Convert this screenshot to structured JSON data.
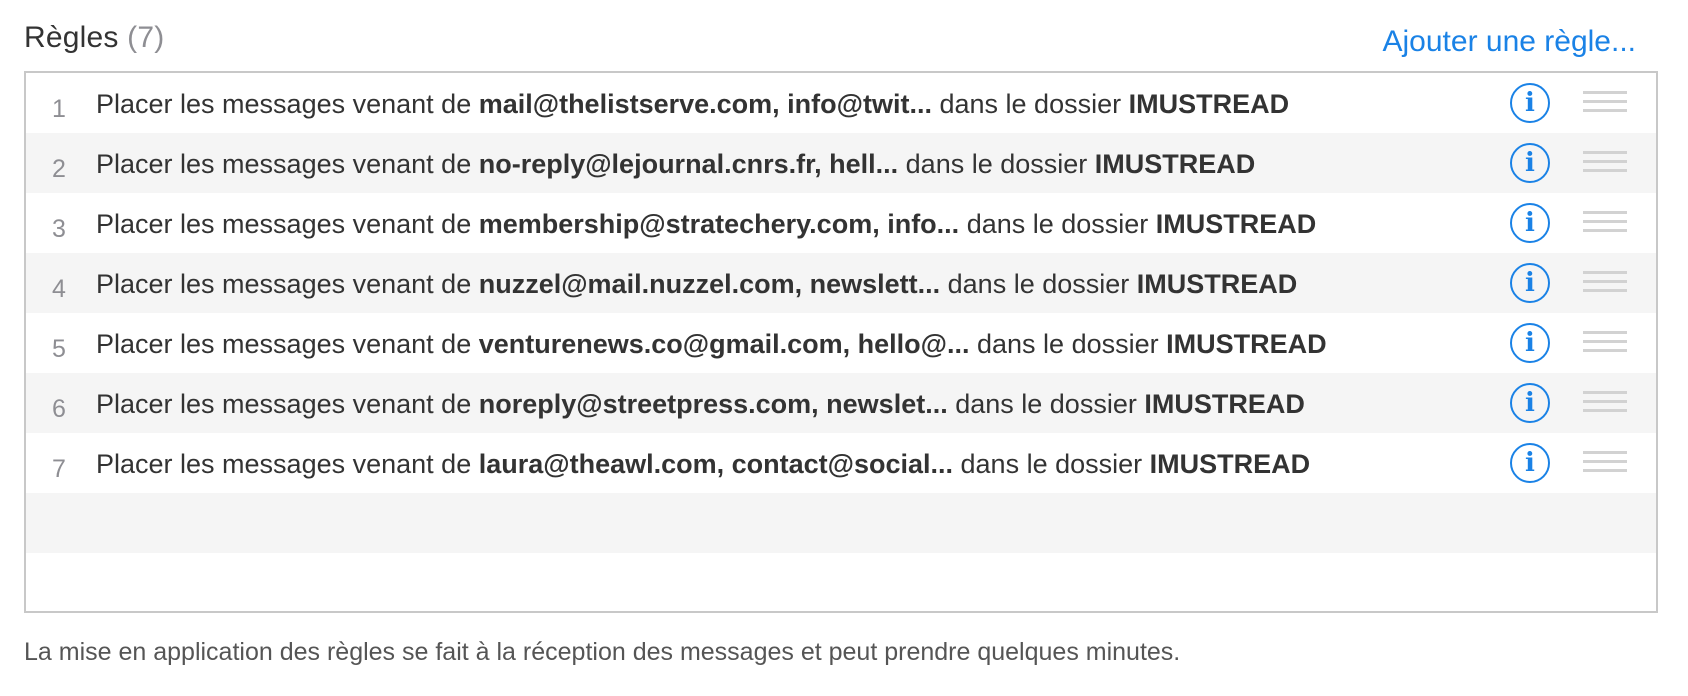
{
  "header": {
    "title": "Règles",
    "count": "(7)",
    "add_rule_label": "Ajouter une règle..."
  },
  "rules": [
    {
      "index": "1",
      "prefix": "Placer les messages venant de ",
      "senders": "mail@thelistserve.com, info@twit...",
      "middle": " dans le dossier ",
      "folder": "IMUSTREAD"
    },
    {
      "index": "2",
      "prefix": "Placer les messages venant de ",
      "senders": "no-reply@lejournal.cnrs.fr, hell...",
      "middle": " dans le dossier ",
      "folder": "IMUSTREAD"
    },
    {
      "index": "3",
      "prefix": "Placer les messages venant de ",
      "senders": "membership@stratechery.com, info...",
      "middle": " dans le dossier ",
      "folder": "IMUSTREAD"
    },
    {
      "index": "4",
      "prefix": "Placer les messages venant de ",
      "senders": "nuzzel@mail.nuzzel.com, newslett...",
      "middle": " dans le dossier ",
      "folder": "IMUSTREAD"
    },
    {
      "index": "5",
      "prefix": "Placer les messages venant de ",
      "senders": "venturenews.co@gmail.com, hello@...",
      "middle": " dans le dossier ",
      "folder": "IMUSTREAD"
    },
    {
      "index": "6",
      "prefix": "Placer les messages venant de ",
      "senders": "noreply@streetpress.com, newslet...",
      "middle": " dans le dossier ",
      "folder": "IMUSTREAD"
    },
    {
      "index": "7",
      "prefix": "Placer les messages venant de ",
      "senders": "laura@theawl.com, contact@social...",
      "middle": " dans le dossier ",
      "folder": "IMUSTREAD"
    }
  ],
  "info_icon_glyph": "i",
  "icons": {
    "info": "info-circle-icon",
    "drag": "drag-handle-icon"
  },
  "colors": {
    "accent": "#1a82e6",
    "row_alt": "#f5f5f5",
    "border": "#c8c8c8"
  },
  "footer": {
    "note": "La mise en application des règles se fait à la réception des messages et peut prendre quelques minutes."
  }
}
